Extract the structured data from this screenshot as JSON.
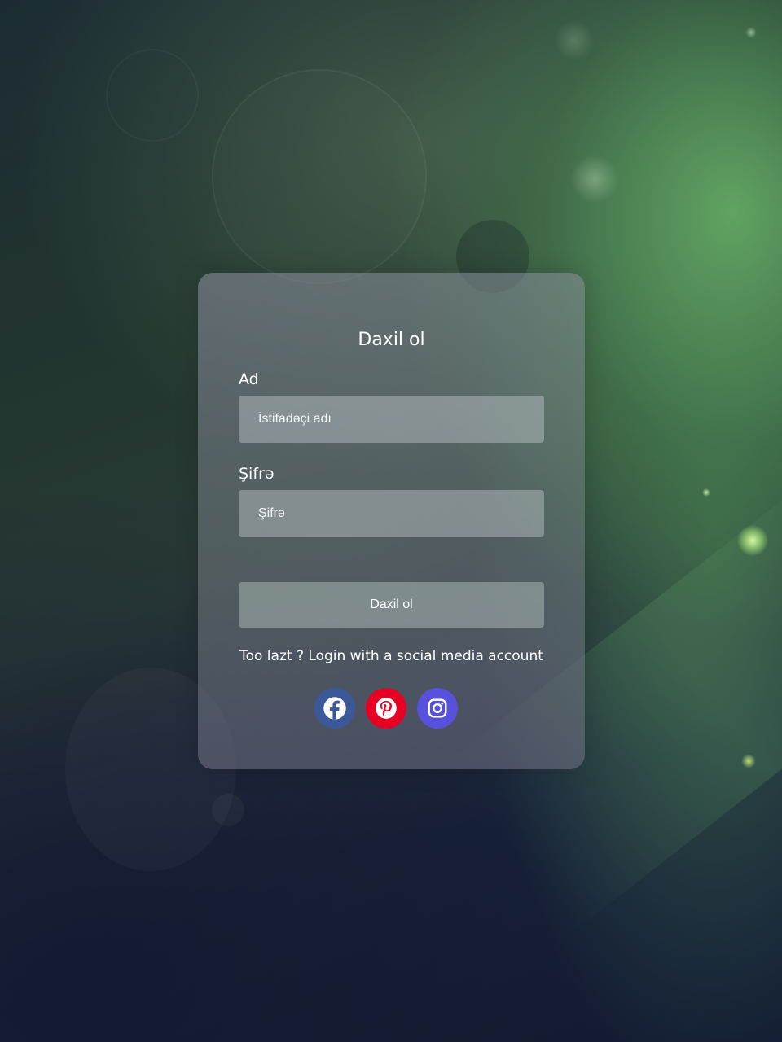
{
  "login": {
    "title": "Daxil ol",
    "username_label": "Ad",
    "username_placeholder": "İstifadəçi adı",
    "password_label": "Şifrə",
    "password_placeholder": "Şifrə",
    "submit_label": "Daxil ol",
    "social_prompt": "Too lazt ? Login with a social media account"
  },
  "social": [
    {
      "name": "Facebook",
      "icon": "facebook-icon",
      "color": "#3b5998"
    },
    {
      "name": "Pinterest",
      "icon": "pinterest-icon",
      "color": "#e60023"
    },
    {
      "name": "Instagram",
      "icon": "instagram-icon",
      "color": "#5851db"
    }
  ]
}
